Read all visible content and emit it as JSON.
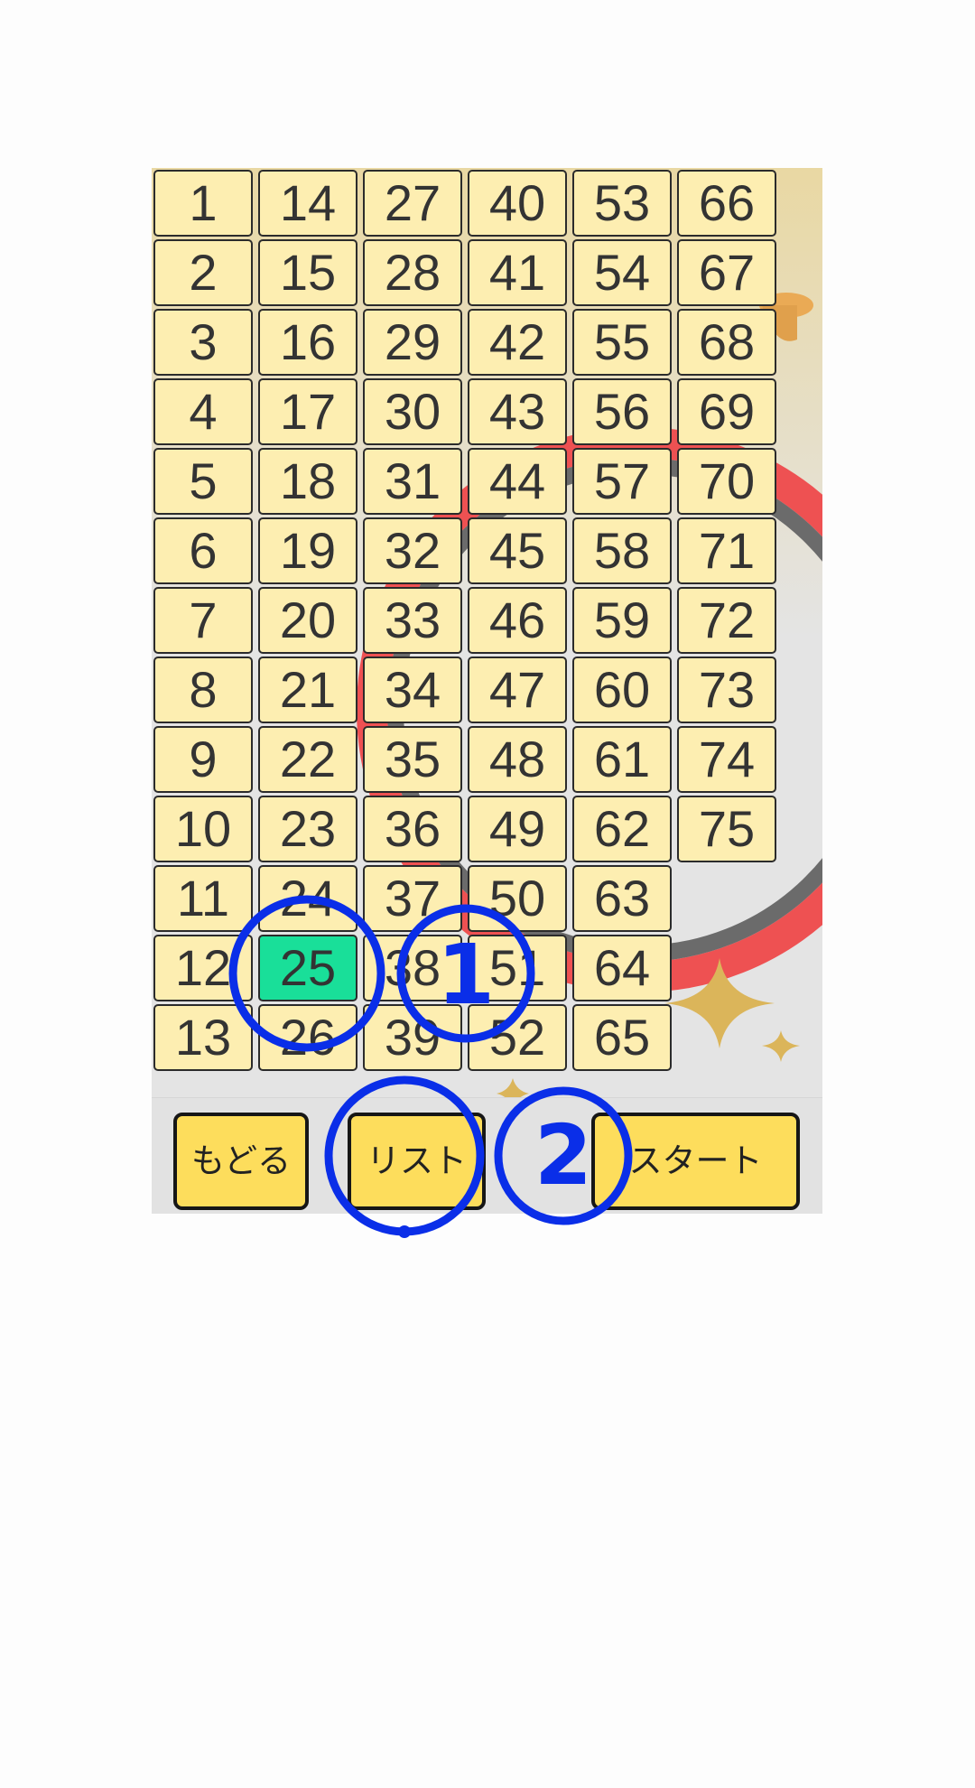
{
  "board": {
    "columns": [
      [
        "1",
        "2",
        "3",
        "4",
        "5",
        "6",
        "7",
        "8",
        "9",
        "10",
        "11",
        "12",
        "13"
      ],
      [
        "14",
        "15",
        "16",
        "17",
        "18",
        "19",
        "20",
        "21",
        "22",
        "23",
        "24",
        "25",
        "26"
      ],
      [
        "27",
        "28",
        "29",
        "30",
        "31",
        "32",
        "33",
        "34",
        "35",
        "36",
        "37",
        "38",
        "39"
      ],
      [
        "40",
        "41",
        "42",
        "43",
        "44",
        "45",
        "46",
        "47",
        "48",
        "49",
        "50",
        "51",
        "52"
      ],
      [
        "53",
        "54",
        "55",
        "56",
        "57",
        "58",
        "59",
        "60",
        "61",
        "62",
        "63",
        "64",
        "65"
      ],
      [
        "66",
        "67",
        "68",
        "69",
        "70",
        "71",
        "72",
        "73",
        "74",
        "75"
      ]
    ],
    "selected_number": "25"
  },
  "buttons": {
    "back_label": "もどる",
    "list_label": "リスト",
    "start_label": "スタート"
  },
  "annotations": {
    "step1_label": "1",
    "step2_label": "2"
  },
  "colors": {
    "cell_background": "#fdeeb1",
    "cell_selected": "#19df99",
    "button_background": "#fddd5c",
    "annotation_blue": "#0a2ee8",
    "decoration_red": "#ee5152"
  },
  "icons": [
    "sparkle-icon",
    "bell-decoration-icon"
  ]
}
